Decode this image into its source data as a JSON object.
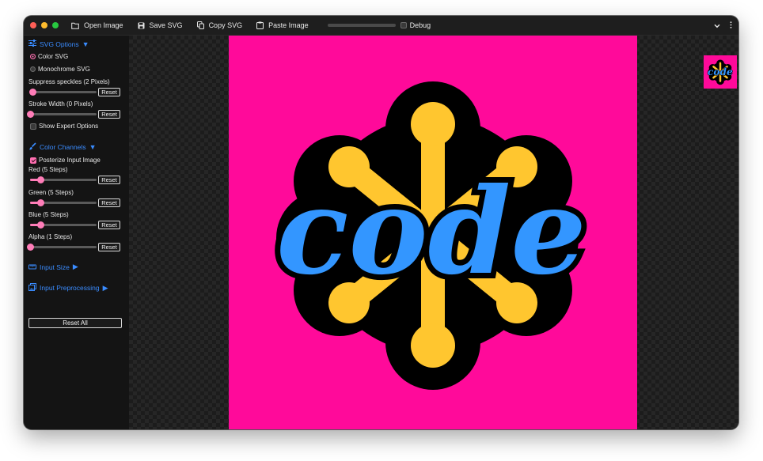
{
  "toolbar": {
    "open_image": "Open Image",
    "save_svg": "Save SVG",
    "copy_svg": "Copy SVG",
    "paste_image": "Paste Image",
    "debug": "Debug",
    "progress_fraction": 0.0
  },
  "svg_options": {
    "title": "SVG Options",
    "color_svg": "Color SVG",
    "monochrome_svg": "Monochrome SVG",
    "selected_mode": "color",
    "suppress_label": "Suppress speckles (2 Pixels)",
    "suppress_fraction": 0.04,
    "stroke_label": "Stroke Width (0 Pixels)",
    "stroke_fraction": 0.0,
    "show_expert": "Show Expert Options",
    "reset": "Reset"
  },
  "color_channels": {
    "title": "Color Channels",
    "posterize": "Posterize Input Image",
    "posterize_checked": true,
    "red_label": "Red (5 Steps)",
    "green_label": "Green (5 Steps)",
    "blue_label": "Blue (5 Steps)",
    "alpha_label": "Alpha (1 Steps)",
    "red_fraction": 0.15,
    "green_fraction": 0.15,
    "blue_fraction": 0.15,
    "alpha_fraction": 0.0,
    "reset": "Reset"
  },
  "input_size": {
    "title": "Input Size"
  },
  "input_preprocessing": {
    "title": "Input Preprocessing"
  },
  "reset_all": "Reset All",
  "artwork": {
    "text": "code"
  },
  "colors": {
    "accent": "#3a8cff",
    "slider": "#ff7db8",
    "artboard": "#ff0a9a",
    "logo_yellow": "#ffc62f",
    "logo_blue": "#3396ff"
  },
  "icons": {
    "open": "folder-icon",
    "save": "floppy-disk-icon",
    "copy": "copy-icon",
    "paste": "clipboard-icon",
    "menu": "chevron-down-icon",
    "more": "vertical-ellipsis-icon",
    "svg_options": "sliders-icon",
    "color_channels": "brush-icon",
    "input_size": "ruler-icon",
    "input_preprocessing": "image-stack-icon"
  }
}
